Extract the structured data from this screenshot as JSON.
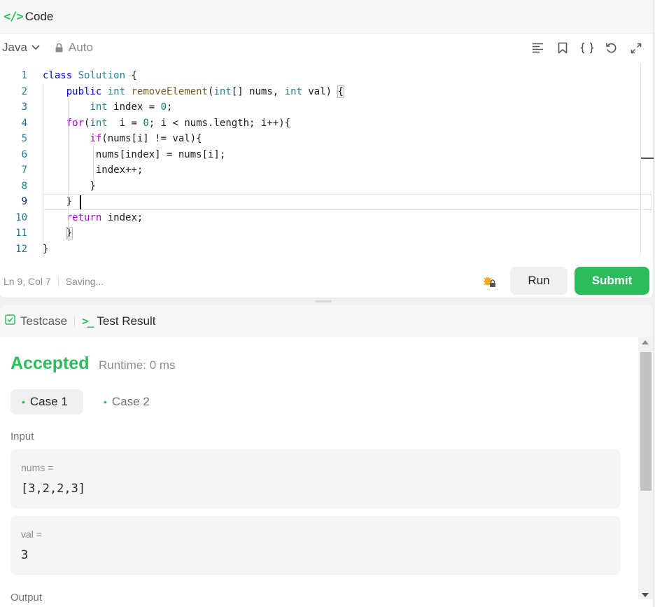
{
  "code_panel": {
    "title": "Code",
    "icon": "code-icon",
    "language": "Java",
    "mode": "Auto",
    "tools": [
      "format-icon",
      "bookmark-icon",
      "braces-icon",
      "reset-icon",
      "expand-icon"
    ],
    "line_numbers": [
      "1",
      "2",
      "3",
      "4",
      "5",
      "6",
      "7",
      "8",
      "9",
      "10",
      "11",
      "12"
    ],
    "status": {
      "position": "Ln 9, Col 7",
      "saving": "Saving..."
    },
    "run_label": "Run",
    "submit_label": "Submit"
  },
  "result_panel": {
    "tabs": [
      "Testcase",
      "Test Result"
    ],
    "verdict": "Accepted",
    "runtime": "Runtime: 0 ms",
    "cases": [
      "Case 1",
      "Case 2"
    ],
    "input_label": "Input",
    "inputs": [
      {
        "name": "nums =",
        "value": "[3,2,2,3]"
      },
      {
        "name": "val =",
        "value": "3"
      }
    ],
    "output_label": "Output"
  },
  "colors": {
    "accent": "#2cbb5d",
    "keyword": "#0000ff",
    "control": "#af00db",
    "type": "#267f99"
  }
}
